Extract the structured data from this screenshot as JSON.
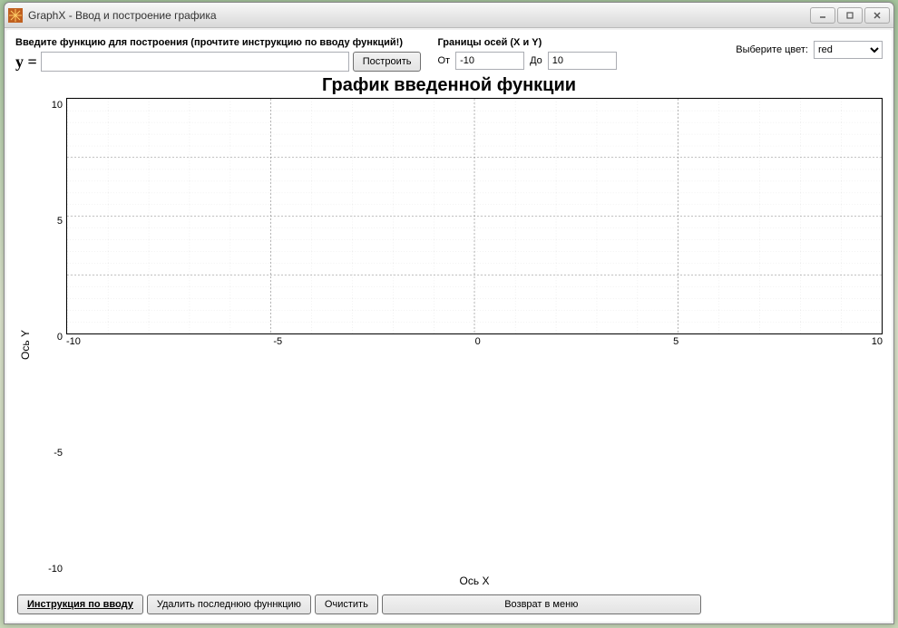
{
  "window": {
    "title": "GraphX -  Ввод и построение графика"
  },
  "controls": {
    "func_label": "Введите функцию для построения  (прочтите инструкцию по вводу функций!)",
    "y_equals": "y =",
    "func_value": "",
    "build_btn": "Построить",
    "axis_label": "Границы осей (X и Y)",
    "from_label": "От",
    "from_value": "-10",
    "to_label": "До",
    "to_value": "10",
    "color_label": "Выберите цвет:",
    "color_value": "red"
  },
  "chart_data": {
    "type": "line",
    "title": "График введенной функции",
    "xlabel": "Ось X",
    "ylabel": "Ось Y",
    "xlim": [
      -10,
      10
    ],
    "ylim": [
      -10,
      10
    ],
    "x_ticks": [
      "-10",
      "-5",
      "0",
      "5",
      "10"
    ],
    "y_ticks": [
      "10",
      "5",
      "0",
      "-5",
      "-10"
    ],
    "series": []
  },
  "footer": {
    "instr_btn": "Инструкция по вводу",
    "del_btn": "Удалить последнюю фуннкцию",
    "clear_btn": "Очистить",
    "back_btn": "Возврат в меню"
  }
}
